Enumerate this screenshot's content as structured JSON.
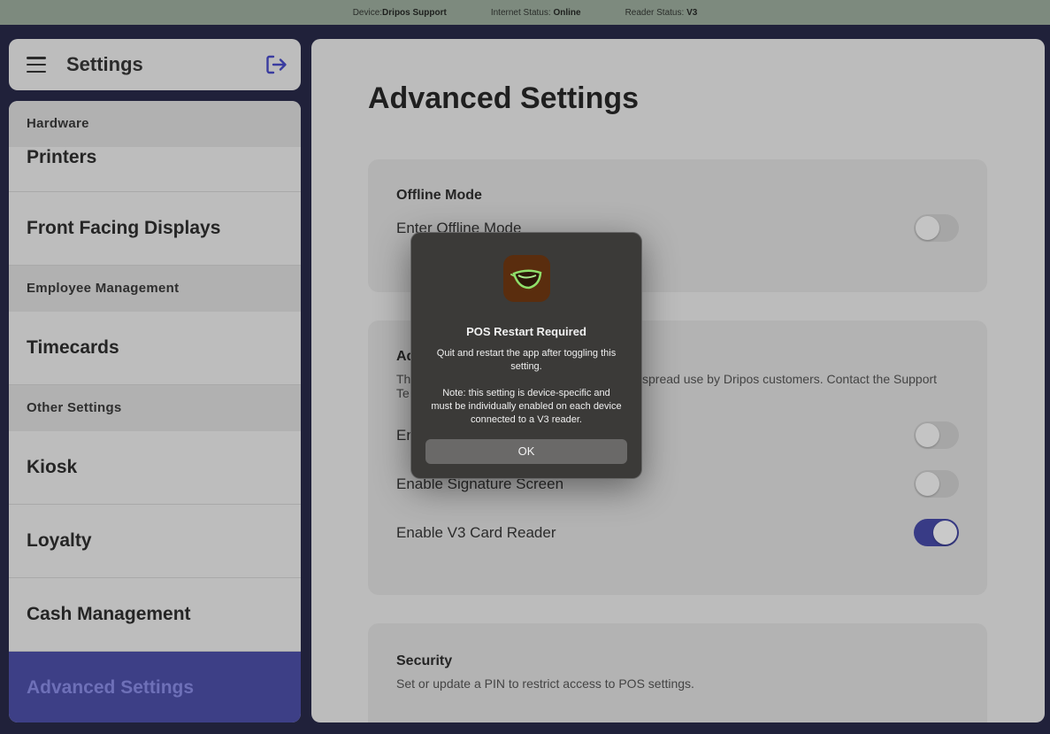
{
  "statusbar": {
    "device_label": "Device:",
    "device_value": "Dripos Support",
    "internet_label": "Internet Status:",
    "internet_value": "Online",
    "reader_label": "Reader Status:",
    "reader_value": "V3"
  },
  "sidebar": {
    "title": "Settings",
    "menu_icon": "hamburger-menu-icon",
    "logout_icon": "logout-icon",
    "accent_color": "#3d3f86",
    "sections": [
      {
        "label": "Hardware"
      },
      {
        "label": "Employee Management"
      },
      {
        "label": "Other Settings"
      }
    ],
    "items": [
      {
        "label": "Printers"
      },
      {
        "label": "Front Facing Displays"
      },
      {
        "label": "Timecards"
      },
      {
        "label": "Kiosk"
      },
      {
        "label": "Loyalty"
      },
      {
        "label": "Cash Management"
      },
      {
        "label": "Advanced Settings",
        "active": true
      }
    ]
  },
  "main": {
    "title": "Advanced Settings",
    "offline": {
      "title": "Offline Mode",
      "row_label": "Enter Offline Mode",
      "toggle_on": false
    },
    "advanced": {
      "title_visible": "Ad",
      "desc_left": "Th",
      "desc_left2": "Te",
      "desc_right": "spread use by Dripos customers. Contact the Support",
      "row1_label_visible": "En",
      "row1_toggle_on": false,
      "row2_label": "Enable Signature Screen",
      "row2_toggle_on": false,
      "row3_label": "Enable V3 Card Reader",
      "row3_toggle_on": true
    },
    "security": {
      "title": "Security",
      "desc": "Set or update a PIN to restrict access to POS settings."
    }
  },
  "dialog": {
    "app_icon": "dripos-cup-icon",
    "title": "POS Restart Required",
    "message": "Quit and restart the app after toggling this setting.\n\nNote: this setting is device-specific and must be individually enabled on each device connected to a V3 reader.",
    "ok_label": "OK"
  }
}
